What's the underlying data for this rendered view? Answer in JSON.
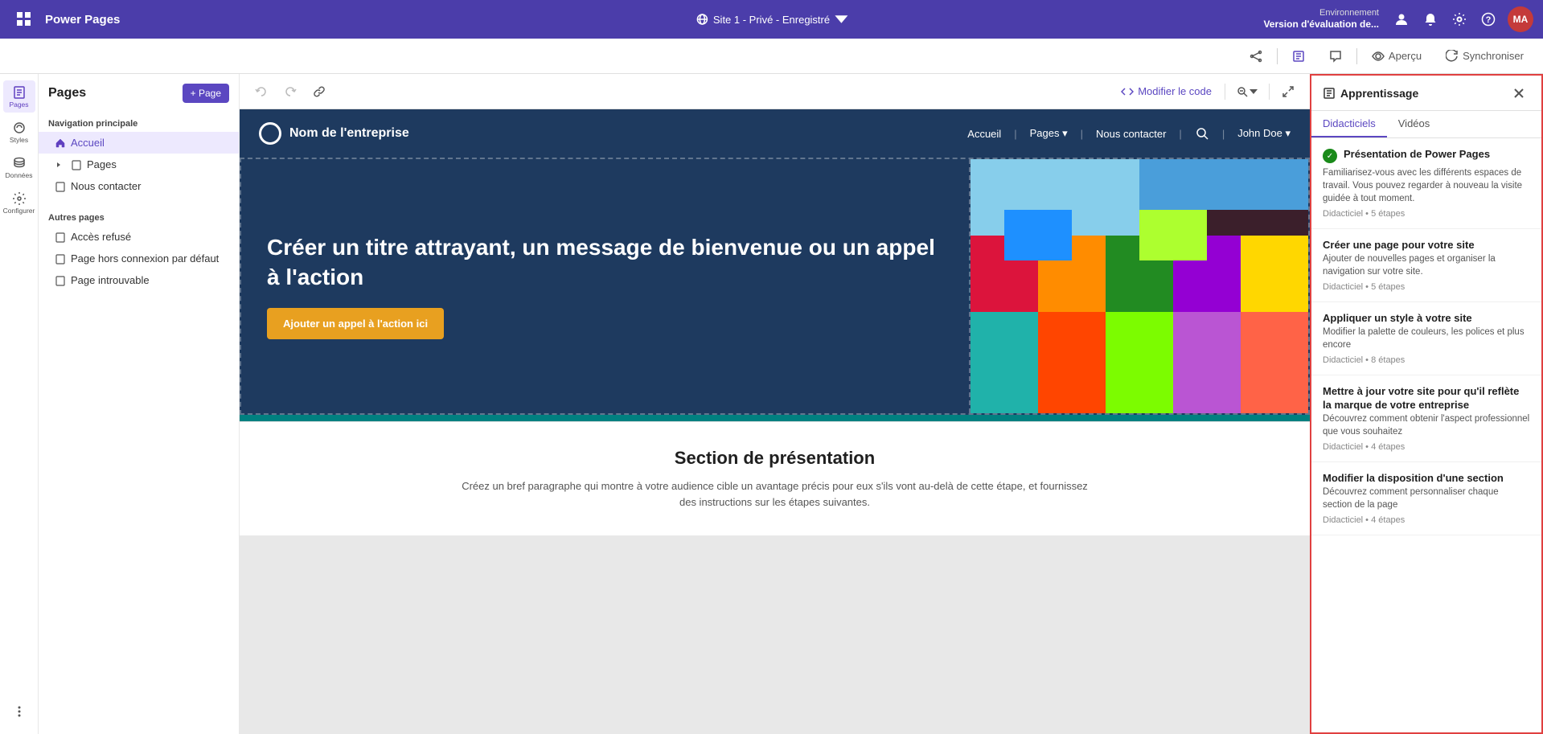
{
  "app": {
    "title": "Power Pages"
  },
  "topbar": {
    "title": "Power Pages",
    "site_info": "Site 1 - Privé - Enregistré",
    "env_label": "Environnement",
    "env_name": "Version d'évaluation de...",
    "avatar_initials": "MA",
    "preview_label": "Aperçu",
    "sync_label": "Synchroniser"
  },
  "pages_panel": {
    "title": "Pages",
    "add_button": "+ Page",
    "nav_main_title": "Navigation principale",
    "nav_other_title": "Autres pages",
    "main_items": [
      {
        "label": "Accueil",
        "active": true
      },
      {
        "label": "Pages",
        "has_children": true
      },
      {
        "label": "Nous contacter"
      }
    ],
    "other_items": [
      {
        "label": "Accès refusé"
      },
      {
        "label": "Page hors connexion par défaut"
      },
      {
        "label": "Page introuvable"
      }
    ]
  },
  "canvas_toolbar": {
    "modify_code": "Modifier le code"
  },
  "website": {
    "company_name": "Nom de l'entreprise",
    "nav_links": [
      "Accueil",
      "Pages",
      "Nous contacter",
      "John Doe"
    ],
    "hero_title": "Créer un titre attrayant, un message de bienvenue ou un appel à l'action",
    "hero_cta": "Ajouter un appel à l'action ici",
    "section_title": "Section de présentation",
    "section_desc": "Créez un bref paragraphe qui montre à votre audience cible un avantage précis pour eux s'ils vont au-delà de cette étape, et fournissez des instructions sur les étapes suivantes."
  },
  "learning_panel": {
    "title": "Apprentissage",
    "tab_tutorials": "Didacticiels",
    "tab_videos": "Vidéos",
    "items": [
      {
        "title": "Présentation de Power Pages",
        "desc": "Familiarisez-vous avec les différents espaces de travail. Vous pouvez regarder à nouveau la visite guidée à tout moment.",
        "meta": "Didacticiel  •  5 étapes",
        "completed": true
      },
      {
        "title": "Créer une page pour votre site",
        "desc": "Ajouter de nouvelles pages et organiser la navigation sur votre site.",
        "meta": "Didacticiel  •  5 étapes",
        "completed": false
      },
      {
        "title": "Appliquer un style à votre site",
        "desc": "Modifier la palette de couleurs, les polices et plus encore",
        "meta": "Didacticiel  •  8 étapes",
        "completed": false
      },
      {
        "title": "Mettre à jour votre site pour qu'il reflète la marque de votre entreprise",
        "desc": "Découvrez comment obtenir l'aspect professionnel que vous souhaitez",
        "meta": "Didacticiel  •  4 étapes",
        "completed": false
      },
      {
        "title": "Modifier la disposition d'une section",
        "desc": "Découvrez comment personnaliser chaque section de la page",
        "meta": "Didacticiel  •  4 étapes",
        "completed": false
      }
    ]
  },
  "icon_nav": [
    {
      "label": "Pages",
      "active": true
    },
    {
      "label": "Styles"
    },
    {
      "label": "Données"
    },
    {
      "label": "Configurer"
    }
  ]
}
